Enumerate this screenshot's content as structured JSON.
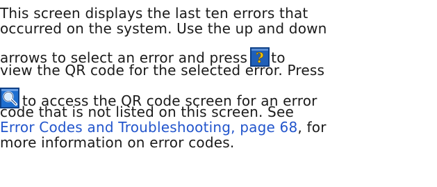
{
  "paragraph": {
    "line1": "This screen displays the last ten errors that",
    "line2": "occurred on the system. Use the up and down",
    "line3_before_icon": "arrows to select an error and press",
    "line3_after_icon": "to",
    "line4": "view the QR code for the selected error. Press",
    "line5_after_icon": "to access the QR code screen for an error",
    "line6": "code that is not listed on this screen.  See",
    "line7_link": "Error Codes and Troubleshooting, page 68",
    "line7_rest": ", for",
    "line8": "more information on error codes."
  },
  "icons": {
    "help": "help-question-icon",
    "search": "magnifier-search-icon"
  },
  "colors": {
    "link": "#2255cc",
    "icon_blue": "#1f5fb8",
    "icon_yellow": "#f2c200"
  }
}
